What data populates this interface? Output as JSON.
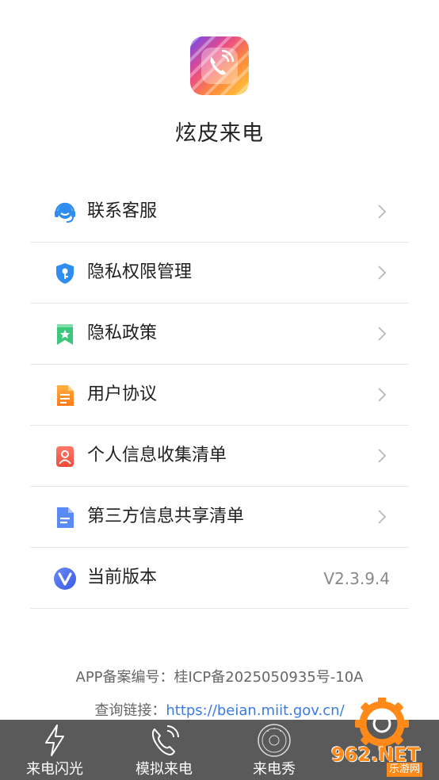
{
  "app": {
    "name": "炫皮来电"
  },
  "menu": [
    {
      "label": "联系客服",
      "icon": "customer-service-icon",
      "color": "#2f8cf0"
    },
    {
      "label": "隐私权限管理",
      "icon": "shield-key-icon",
      "color": "#2f8cf0"
    },
    {
      "label": "隐私政策",
      "icon": "bookmark-star-icon",
      "color": "#3cc87a"
    },
    {
      "label": "用户协议",
      "icon": "document-icon",
      "color": "#ff8a1a"
    },
    {
      "label": "个人信息收集清单",
      "icon": "user-card-icon",
      "color": "#f05a4a"
    },
    {
      "label": "第三方信息共享清单",
      "icon": "file-lines-icon",
      "color": "#4a7cf0"
    },
    {
      "label": "当前版本",
      "icon": "version-v-icon",
      "color": "#4a6cf0",
      "value": "V2.3.9.4"
    }
  ],
  "footer": {
    "beian": "APP备案编号：桂ICP备2025050935号-10A",
    "query_label": "查询链接：",
    "query_link": "https://beian.miit.gov.cn/"
  },
  "tabbar": [
    {
      "label": "来电闪光",
      "icon": "lightning-icon"
    },
    {
      "label": "模拟来电",
      "icon": "phone-ring-icon"
    },
    {
      "label": "来电秀",
      "icon": "call-show-badge-icon"
    }
  ],
  "watermark": {
    "text": "962.NET",
    "sub": "乐游网"
  },
  "colors": {
    "tabbar_bg": "#5a5a5a",
    "link": "#3a7be0",
    "accent": "#ff8a1a"
  }
}
